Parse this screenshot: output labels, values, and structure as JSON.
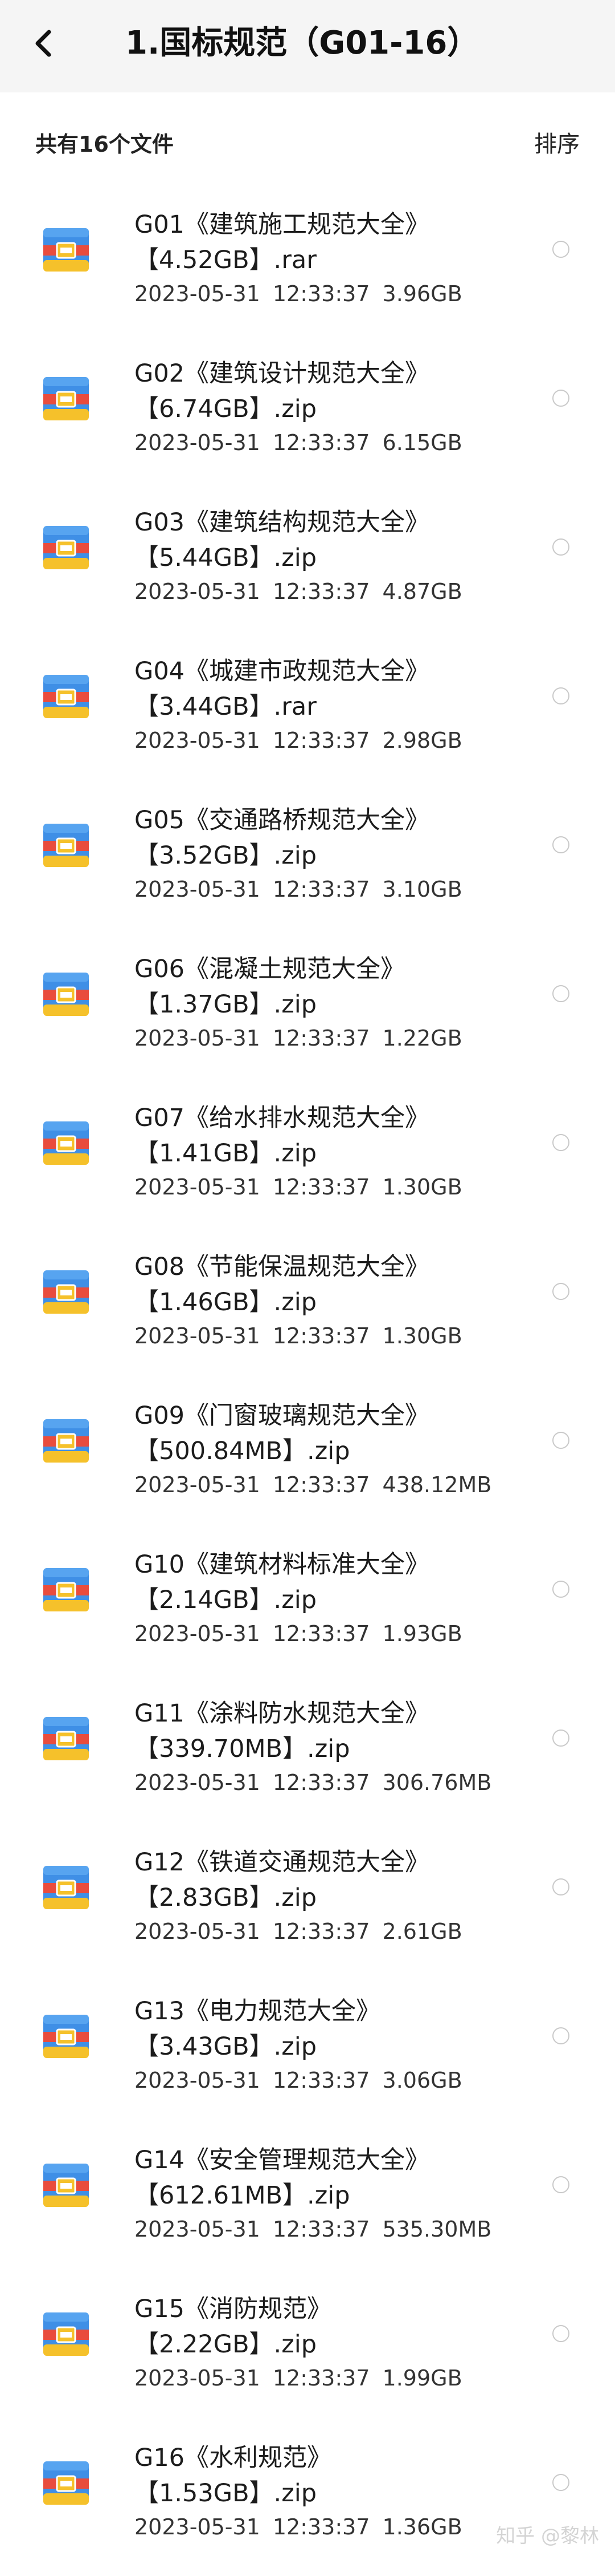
{
  "header": {
    "title": "1.国标规范（G01-16）"
  },
  "list_header": {
    "count_label": "共有16个文件",
    "sort_label": "排序"
  },
  "files": [
    {
      "name": "G01《建筑施工规范大全》",
      "size_ext": "【4.52GB】.rar",
      "date": "2023-05-31",
      "time": "12:33:37",
      "size": "3.96GB"
    },
    {
      "name": "G02《建筑设计规范大全》",
      "size_ext": "【6.74GB】.zip",
      "date": "2023-05-31",
      "time": "12:33:37",
      "size": "6.15GB"
    },
    {
      "name": "G03《建筑结构规范大全》",
      "size_ext": "【5.44GB】.zip",
      "date": "2023-05-31",
      "time": "12:33:37",
      "size": "4.87GB"
    },
    {
      "name": "G04《城建市政规范大全》",
      "size_ext": "【3.44GB】.rar",
      "date": "2023-05-31",
      "time": "12:33:37",
      "size": "2.98GB"
    },
    {
      "name": "G05《交通路桥规范大全》",
      "size_ext": "【3.52GB】.zip",
      "date": "2023-05-31",
      "time": "12:33:37",
      "size": "3.10GB"
    },
    {
      "name": "G06《混凝土规范大全》",
      "size_ext": "【1.37GB】.zip",
      "date": "2023-05-31",
      "time": "12:33:37",
      "size": "1.22GB"
    },
    {
      "name": "G07《给水排水规范大全》",
      "size_ext": "【1.41GB】.zip",
      "date": "2023-05-31",
      "time": "12:33:37",
      "size": "1.30GB"
    },
    {
      "name": "G08《节能保温规范大全》",
      "size_ext": "【1.46GB】.zip",
      "date": "2023-05-31",
      "time": "12:33:37",
      "size": "1.30GB"
    },
    {
      "name": "G09《门窗玻璃规范大全》",
      "size_ext": "【500.84MB】.zip",
      "date": "2023-05-31",
      "time": "12:33:37",
      "size": "438.12MB"
    },
    {
      "name": "G10《建筑材料标准大全》",
      "size_ext": "【2.14GB】.zip",
      "date": "2023-05-31",
      "time": "12:33:37",
      "size": "1.93GB"
    },
    {
      "name": "G11《涂料防水规范大全》",
      "size_ext": "【339.70MB】.zip",
      "date": "2023-05-31",
      "time": "12:33:37",
      "size": "306.76MB"
    },
    {
      "name": "G12《铁道交通规范大全》",
      "size_ext": "【2.83GB】.zip",
      "date": "2023-05-31",
      "time": "12:33:37",
      "size": "2.61GB"
    },
    {
      "name": "G13《电力规范大全》",
      "size_ext": "【3.43GB】.zip",
      "date": "2023-05-31",
      "time": "12:33:37",
      "size": "3.06GB"
    },
    {
      "name": "G14《安全管理规范大全》",
      "size_ext": "【612.61MB】.zip",
      "date": "2023-05-31",
      "time": "12:33:37",
      "size": "535.30MB"
    },
    {
      "name": "G15《消防规范》",
      "size_ext": "【2.22GB】.zip",
      "date": "2023-05-31",
      "time": "12:33:37",
      "size": "1.99GB"
    },
    {
      "name": "G16《水利规范》",
      "size_ext": "【1.53GB】.zip",
      "date": "2023-05-31",
      "time": "12:33:37",
      "size": "1.36GB"
    }
  ],
  "icons": {
    "back": "chevron-left-icon",
    "file": "archive-file-icon",
    "select": "radio-circle"
  },
  "watermark": "知乎 @黎林",
  "colors": {
    "header_bg": "#f5f5f5",
    "archive_blue": "#3f8fe6",
    "archive_red": "#e94c3d",
    "archive_yellow": "#f5c12b"
  }
}
